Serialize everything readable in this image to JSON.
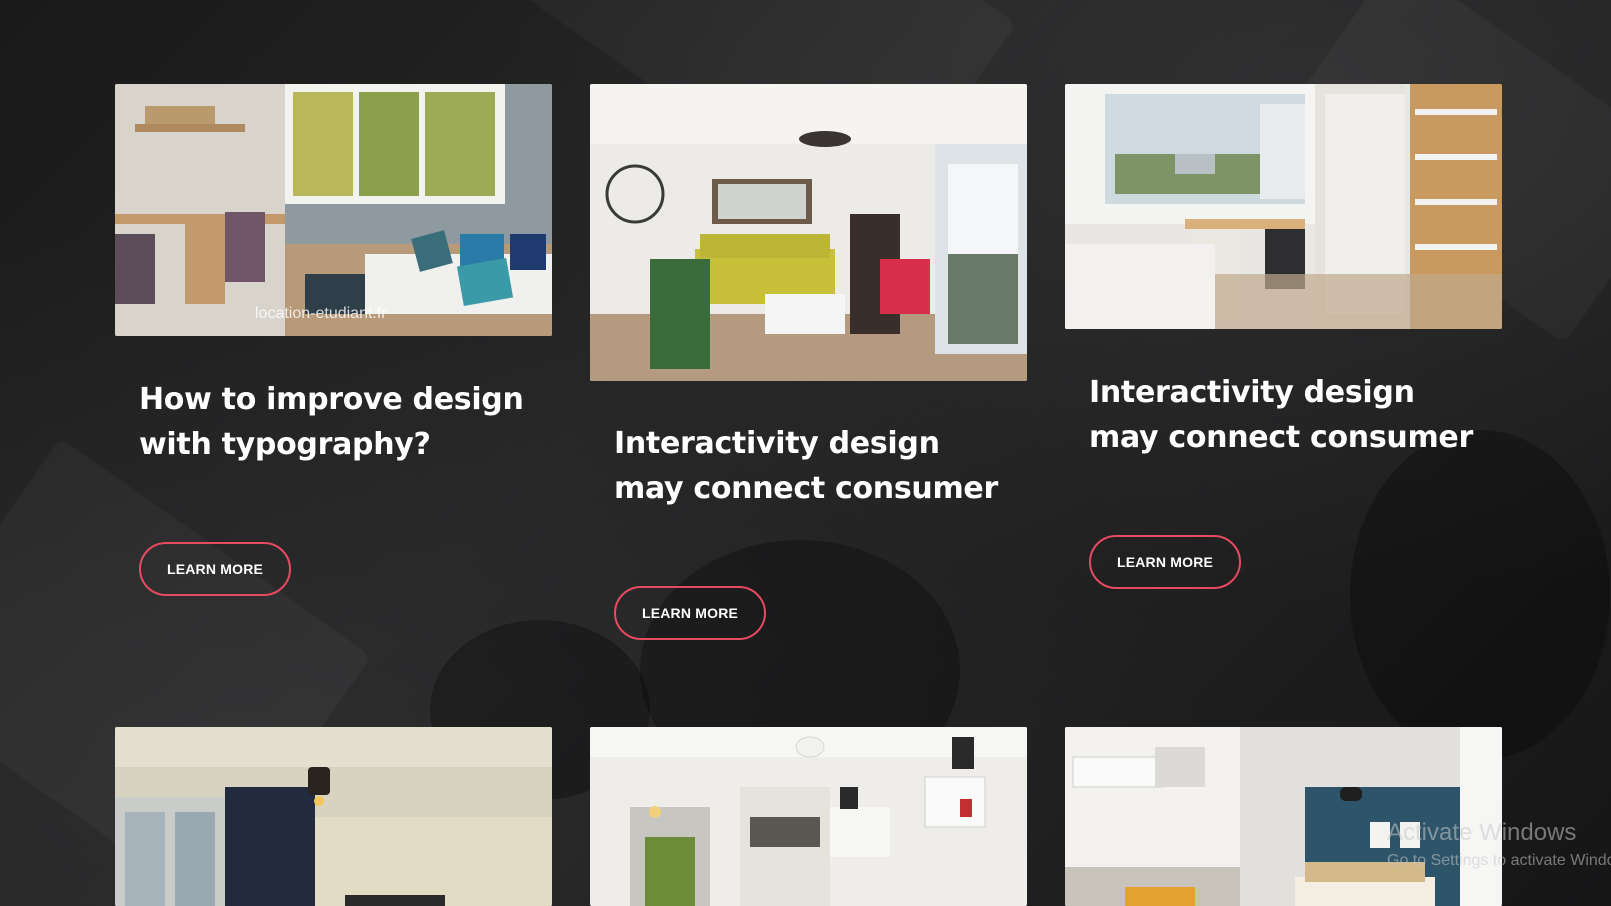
{
  "cards": [
    {
      "title": "How to improve design with typography?",
      "button_label": "LEARN MORE",
      "image_caption": "location-etudiant.fr"
    },
    {
      "title": "Interactivity design may connect consumer",
      "button_label": "LEARN MORE"
    },
    {
      "title": "Interactivity design may connect consumer",
      "button_label": "LEARN MORE"
    }
  ],
  "watermark": {
    "title": "Activate Windows",
    "subtitle": "Go to Settings to activate Windows."
  },
  "colors": {
    "background": "#1c1c1d",
    "button_border": "#e84a5f",
    "text": "#ffffff"
  }
}
